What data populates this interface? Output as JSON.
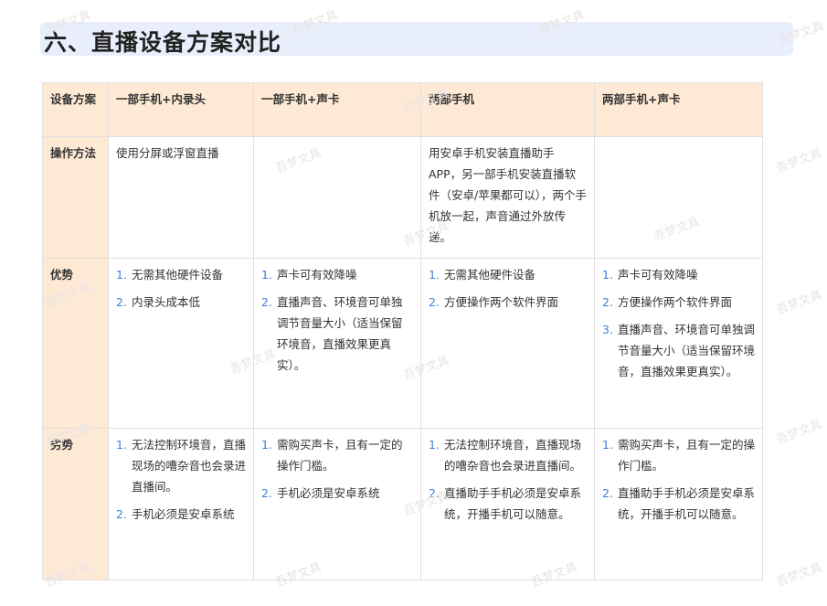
{
  "title": "六、直播设备方案对比",
  "table": {
    "headers": [
      "设备方案",
      "一部手机+内录头",
      "一部手机+声卡",
      "两部手机",
      "两部手机+声卡"
    ],
    "rows": [
      {
        "label": "操作方法",
        "cells": [
          "使用分屏或浮窗直播",
          "",
          "用安卓手机安装直播助手APP，另一部手机安装直播软件（安卓/苹果都可以），两个手机放一起，声音通过外放传递。",
          ""
        ]
      },
      {
        "label": "优势",
        "lists": [
          [
            "无需其他硬件设备",
            "内录头成本低"
          ],
          [
            "声卡可有效降噪",
            "直播声音、环境音可单独调节音量大小（适当保留环境音，直播效果更真实）。"
          ],
          [
            "无需其他硬件设备",
            "方便操作两个软件界面"
          ],
          [
            "声卡可有效降噪",
            "方便操作两个软件界面",
            "直播声音、环境音可单独调节音量大小（适当保留环境音，直播效果更真实）。"
          ]
        ]
      },
      {
        "label": "劣势",
        "lists": [
          [
            "无法控制环境音，直播现场的嘈杂音也会录进直播间。",
            "手机必须是安卓系统"
          ],
          [
            "需购买声卡，且有一定的操作门槛。",
            "手机必须是安卓系统"
          ],
          [
            "无法控制环境音，直播现场的嘈杂音也会录进直播间。",
            "直播助手手机必须是安卓系统，开播手机可以随意。"
          ],
          [
            "需购买声卡，且有一定的操作门槛。",
            "直播助手手机必须是安卓系统，开播手机可以随意。"
          ]
        ]
      }
    ]
  },
  "list_numbers": [
    "1.",
    "2.",
    "3."
  ],
  "watermark": "吾梦文具"
}
